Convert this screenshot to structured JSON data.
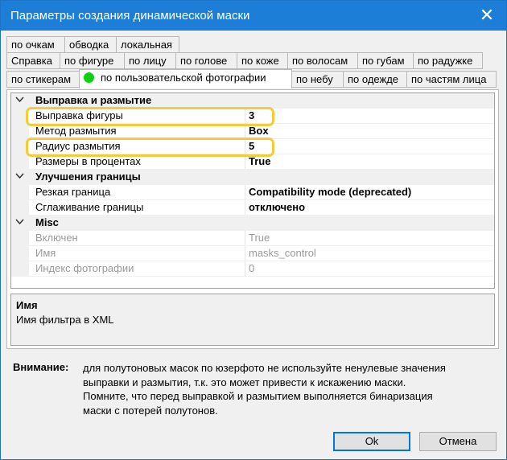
{
  "window": {
    "title": "Параметры создания динамической маски",
    "close_glyph": "✕"
  },
  "tabs": {
    "row1": [
      "по очкам",
      "обводка",
      "локальная"
    ],
    "row2": [
      "Справка",
      "по фигуре",
      "по лицу",
      "по голове",
      "по коже",
      "по волосам",
      "по губам",
      "по радужке"
    ],
    "row3": [
      "по стикерам",
      "по пользовательской фотографии",
      "по небу",
      "по одежде",
      "по частям лица"
    ],
    "active": "по пользовательской фотографии",
    "active_dot_color": "#0ed10e"
  },
  "grid": {
    "categories": [
      {
        "label": "Выправка и размытие",
        "rows": [
          {
            "name": "Выправка фигуры",
            "value": "3",
            "highlight": true
          },
          {
            "name": "Метод размытия",
            "value": "Box"
          },
          {
            "name": "Радиус размытия",
            "value": "5",
            "highlight": true
          },
          {
            "name": "Размеры в процентах",
            "value": "True"
          }
        ]
      },
      {
        "label": "Улучшения границы",
        "rows": [
          {
            "name": "Резкая граница",
            "value": "Compatibility mode (deprecated)"
          },
          {
            "name": "Сглаживание границы",
            "value": "отключено"
          }
        ]
      },
      {
        "label": "Misc",
        "rows": [
          {
            "name": "Включен",
            "value": "True",
            "disabled": true
          },
          {
            "name": "Имя",
            "value": "masks_control",
            "disabled": true
          },
          {
            "name": "Индекс фотографии",
            "value": "0",
            "disabled": true
          }
        ]
      }
    ],
    "highlight_color": "#f4cc3a"
  },
  "description": {
    "title": "Имя",
    "text": "Имя фильтра в XML"
  },
  "warning": {
    "label": "Внимание:",
    "lines": [
      "для полутоновых масок по юзерфото не используйте ненулевые значения",
      "выправки и размытия, т.к. это может привести к искажению маски.",
      "Помните, что перед выправкой и размытием выполняется бинаризация",
      "маски с потерей полутонов."
    ]
  },
  "buttons": {
    "ok": "Ok",
    "cancel": "Отмена"
  }
}
